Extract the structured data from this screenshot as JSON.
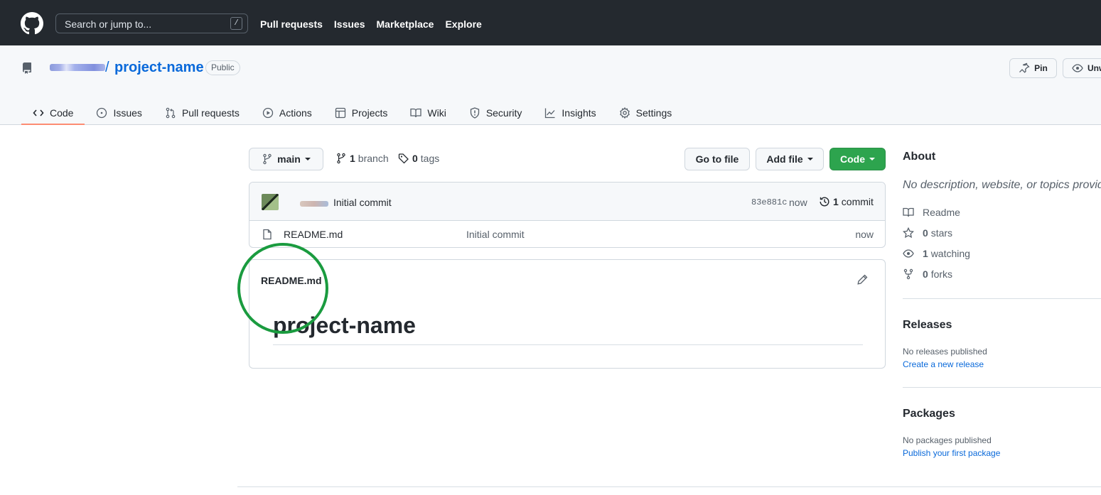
{
  "header": {
    "search_placeholder": "Search or jump to...",
    "search_shortcut": "/",
    "nav": [
      "Pull requests",
      "Issues",
      "Marketplace",
      "Explore"
    ]
  },
  "repo": {
    "slash": "/",
    "name": "project-name",
    "visibility": "Public",
    "pin_label": "Pin",
    "unwatch_label": "Unw",
    "tabs": [
      {
        "label": "Code",
        "icon": "code-icon",
        "selected": true
      },
      {
        "label": "Issues",
        "icon": "issue-icon"
      },
      {
        "label": "Pull requests",
        "icon": "pull-request-icon"
      },
      {
        "label": "Actions",
        "icon": "play-icon"
      },
      {
        "label": "Projects",
        "icon": "table-icon"
      },
      {
        "label": "Wiki",
        "icon": "book-icon"
      },
      {
        "label": "Security",
        "icon": "shield-icon"
      },
      {
        "label": "Insights",
        "icon": "graph-icon"
      },
      {
        "label": "Settings",
        "icon": "gear-icon"
      }
    ]
  },
  "toolbar": {
    "branch": "main",
    "branch_count": "1",
    "branch_label": "branch",
    "tag_count": "0",
    "tag_label": "tags",
    "go_to_file": "Go to file",
    "add_file": "Add file",
    "code": "Code"
  },
  "latest_commit": {
    "message": "Initial commit",
    "sha": "83e881c",
    "when": "now",
    "count": "1",
    "count_label": "commit"
  },
  "files": [
    {
      "name": "README.md",
      "commit": "Initial commit",
      "age": "now"
    }
  ],
  "readme": {
    "label": "README.md",
    "title": "project-name"
  },
  "about": {
    "heading": "About",
    "description": "No description, website, or topics provide",
    "readme": "Readme",
    "stars_count": "0",
    "stars_label": "stars",
    "watching_count": "1",
    "watching_label": "watching",
    "forks_count": "0",
    "forks_label": "forks"
  },
  "releases": {
    "heading": "Releases",
    "empty": "No releases published",
    "link": "Create a new release"
  },
  "packages": {
    "heading": "Packages",
    "empty": "No packages published",
    "link": "Publish your first package"
  },
  "colors": {
    "header_bg": "#24292f",
    "link": "#0969da",
    "primary_button": "#2da44e",
    "selected_tab_underline": "#fd8c73",
    "annotation_circle": "#1a9b3f"
  }
}
